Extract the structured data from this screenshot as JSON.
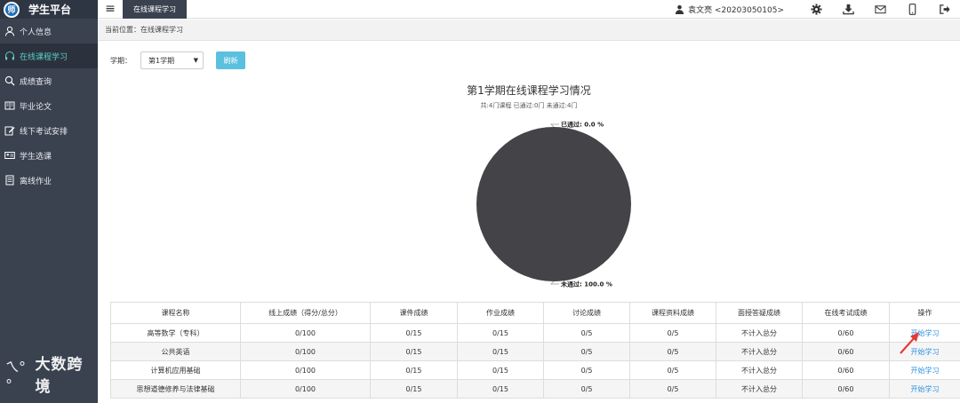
{
  "app": {
    "title": "学生平台",
    "logo_letter": "师"
  },
  "sidebar": {
    "items": [
      {
        "label": "个人信息",
        "icon": "user-icon",
        "active": false
      },
      {
        "label": "在线课程学习",
        "icon": "headphones-icon",
        "active": true
      },
      {
        "label": "成绩查询",
        "icon": "search-icon",
        "active": false
      },
      {
        "label": "毕业论文",
        "icon": "book-icon",
        "active": false
      },
      {
        "label": "线下考试安排",
        "icon": "edit-icon",
        "active": false
      },
      {
        "label": "学生选课",
        "icon": "id-card-icon",
        "active": false
      },
      {
        "label": "离线作业",
        "icon": "document-icon",
        "active": false
      }
    ]
  },
  "watermark": {
    "logo": "ㄟ°°",
    "text": "大数跨境"
  },
  "topbar": {
    "active_tab": "在线课程学习",
    "user_name": "袁文亮 <20203050105>",
    "icons": [
      "gear-icon",
      "download-icon",
      "mail-icon",
      "mobile-icon",
      "logout-icon"
    ]
  },
  "breadcrumb": {
    "prefix": "当前位置：",
    "current": "在线课程学习"
  },
  "filters": {
    "term_label": "学期：",
    "term_value": "第1学期",
    "refresh_label": "刷新"
  },
  "chart_data": {
    "type": "pie",
    "title": "第1学期在线课程学习情况",
    "subtitle": "共:4门课程 已通过:0门 未通过:4门",
    "slices": [
      {
        "name": "已通过",
        "value": 0.0,
        "label": "已通过: 0.0 %",
        "color": "#3a9fd6"
      },
      {
        "name": "未通过",
        "value": 100.0,
        "label": "未通过: 100.0 %",
        "color": "#434348"
      }
    ]
  },
  "table": {
    "headers": [
      "课程名称",
      "线上成绩（得分/总分）",
      "课件成绩",
      "作业成绩",
      "讨论成绩",
      "课程资料成绩",
      "面授答疑成绩",
      "在线考试成绩",
      "操作"
    ],
    "rows": [
      [
        "高等数学（专科）",
        "0/100",
        "0/15",
        "0/15",
        "0/5",
        "0/5",
        "不计入总分",
        "0/60",
        "开始学习"
      ],
      [
        "公共英语",
        "0/100",
        "0/15",
        "0/15",
        "0/5",
        "0/5",
        "不计入总分",
        "0/60",
        "开始学习"
      ],
      [
        "计算机应用基础",
        "0/100",
        "0/15",
        "0/15",
        "0/5",
        "0/5",
        "不计入总分",
        "0/60",
        "开始学习"
      ],
      [
        "思想道德修养与法律基础",
        "0/100",
        "0/15",
        "0/15",
        "0/5",
        "0/5",
        "不计入总分",
        "0/60",
        "开始学习"
      ]
    ]
  },
  "colors": {
    "sidebar_bg": "#3a4250",
    "active_text": "#5ad0c7",
    "refresh_btn": "#5bc0de",
    "link": "#2b8fdf",
    "annotation_arrow": "#e53935"
  }
}
